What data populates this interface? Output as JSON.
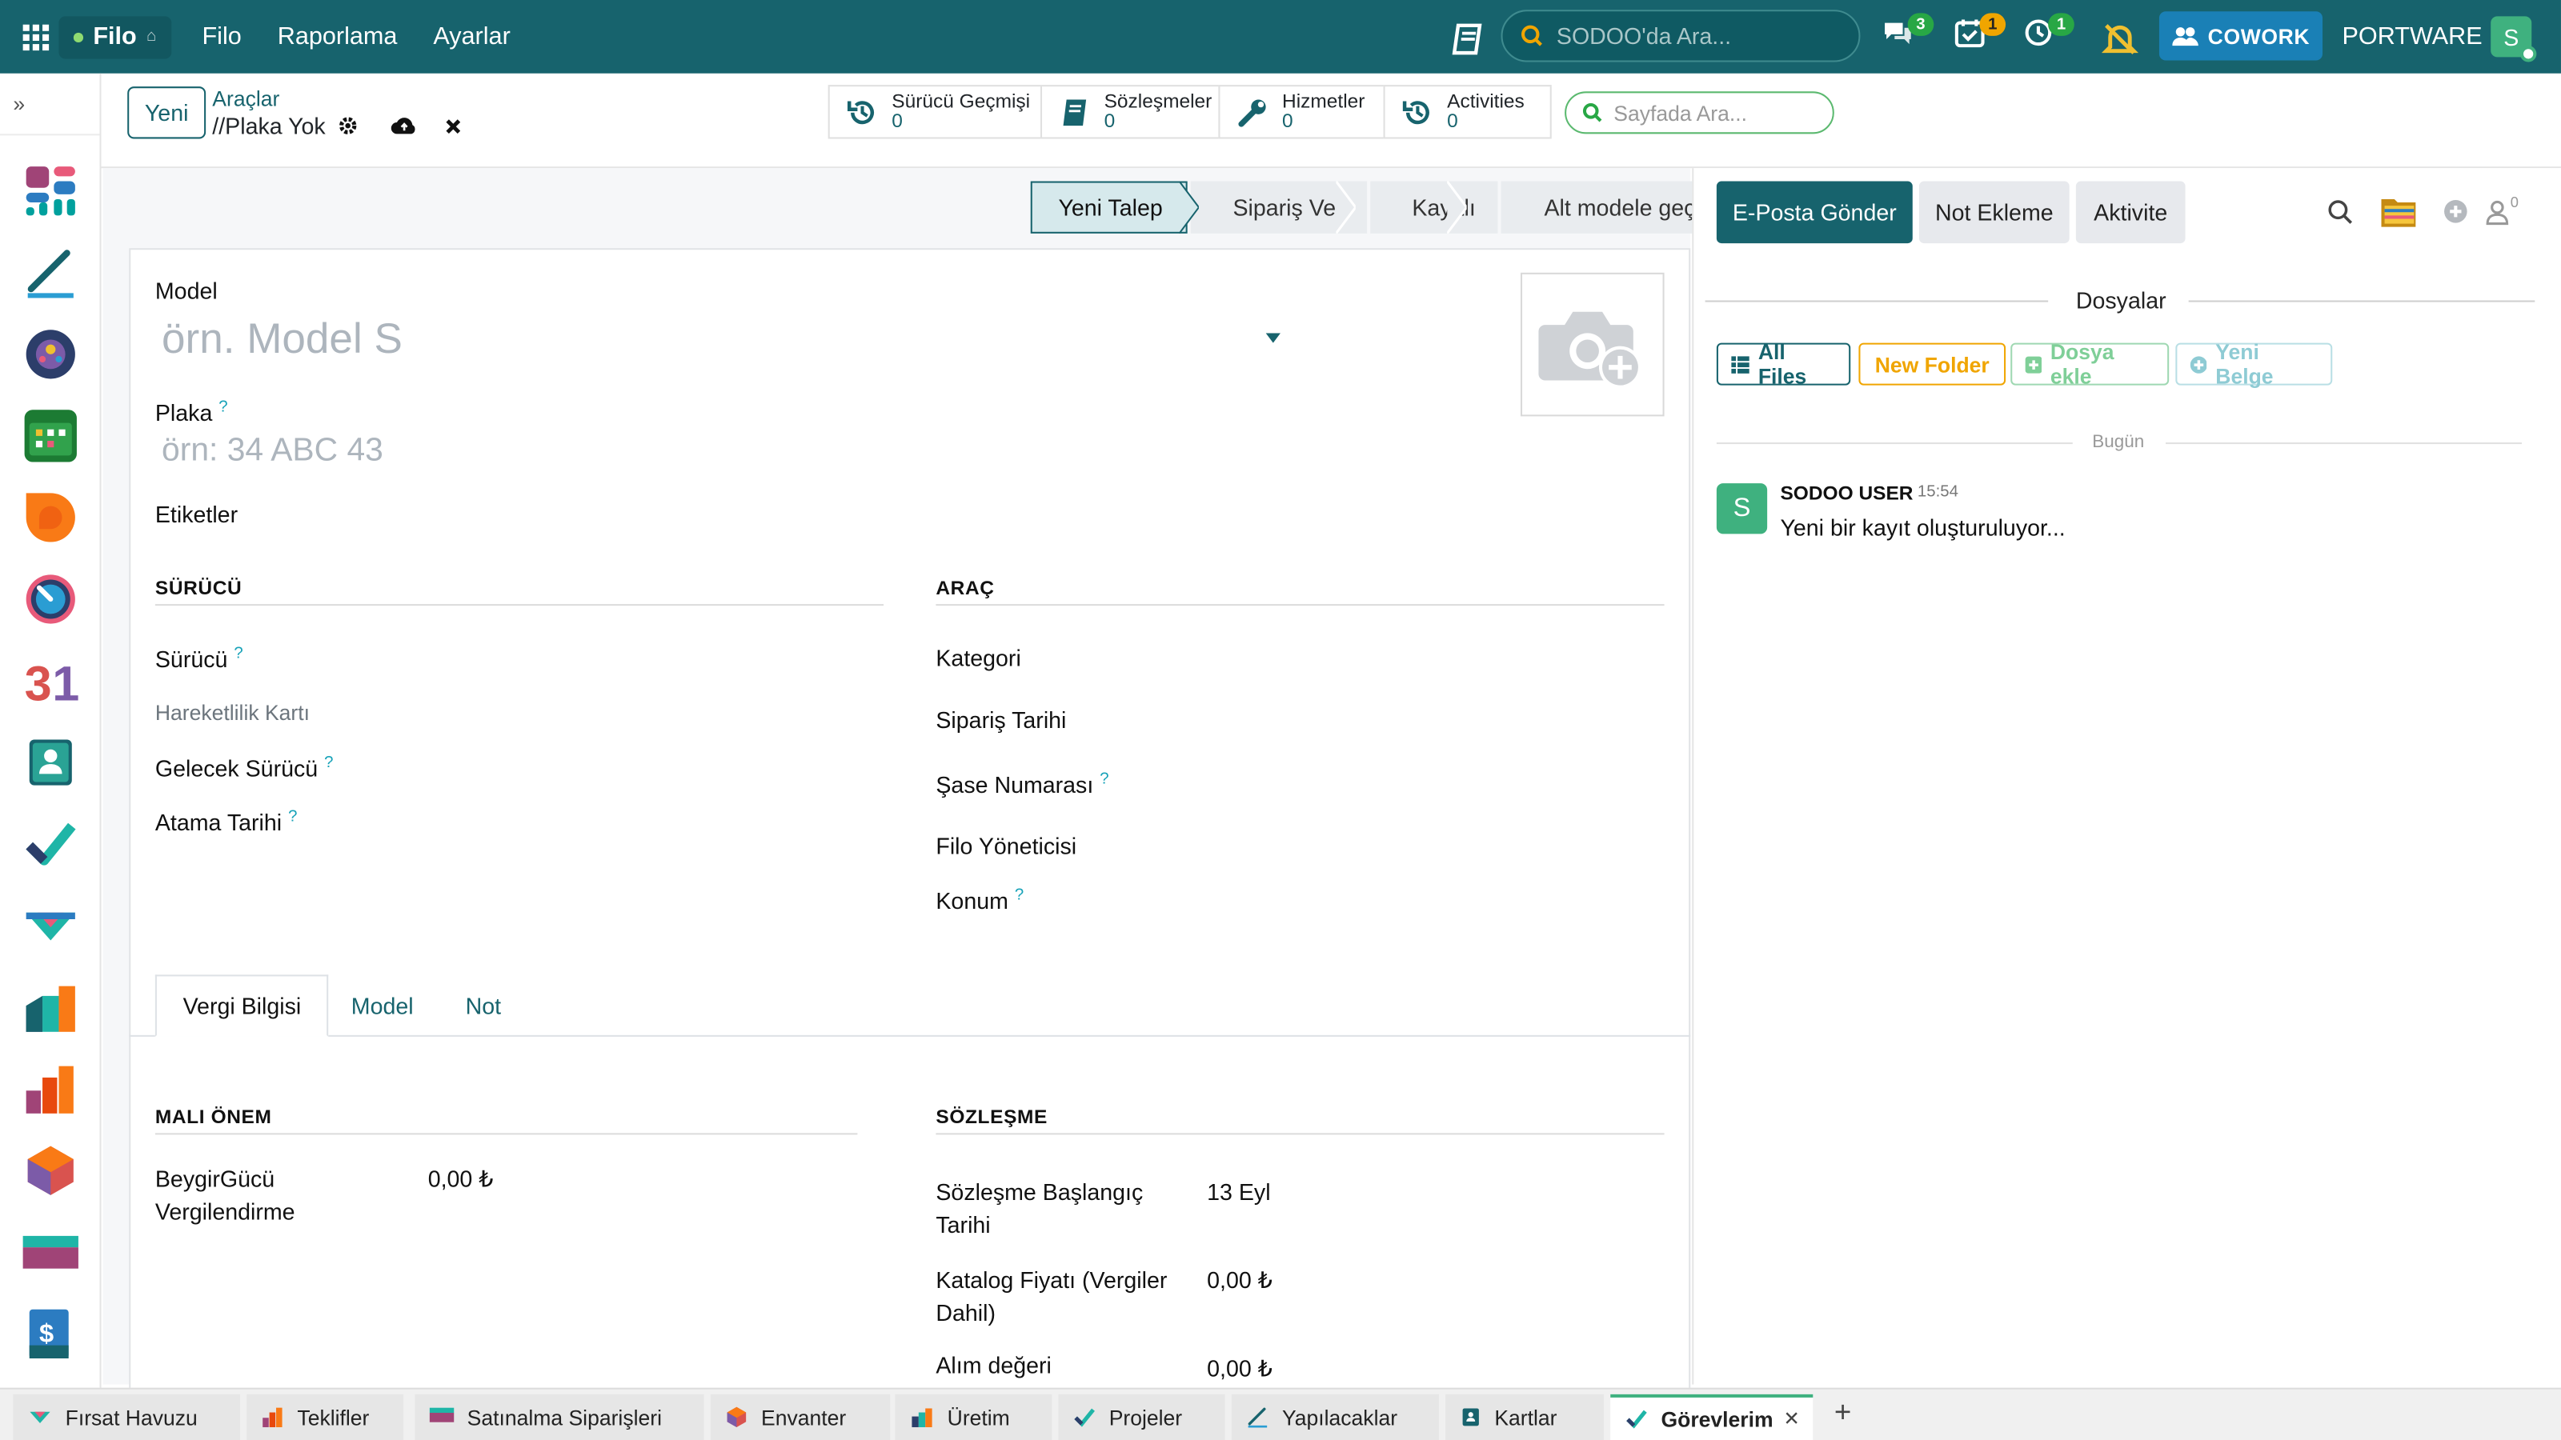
{
  "topbar": {
    "app_name": "Filo",
    "menu": [
      "Filo",
      "Raporlama",
      "Ayarlar"
    ],
    "search_placeholder": "SODOO'da Ara...",
    "messages_count": "3",
    "activities_count": "1",
    "timer_count": "1",
    "cowork_label": "COWORK",
    "company": "PORTWARE",
    "avatar_letter": "S"
  },
  "control_panel": {
    "new_button": "Yeni",
    "breadcrumb_parent": "Araçlar",
    "breadcrumb_current": "//Plaka Yok",
    "smart_buttons": [
      {
        "label": "Sürücü Geçmişi",
        "value": "0",
        "icon": "history-icon"
      },
      {
        "label": "Sözleşmeler",
        "value": "0",
        "icon": "book-icon"
      },
      {
        "label": "Hizmetler",
        "value": "0",
        "icon": "wrench-icon"
      },
      {
        "label": "Activities",
        "value": "0",
        "icon": "history-icon"
      }
    ],
    "page_search_placeholder": "Sayfada Ara..."
  },
  "status_stages": [
    "Yeni Talep",
    "Sipariş Ver",
    "Kayıtlı",
    "Alt modele geçildi"
  ],
  "form": {
    "model_label": "Model",
    "model_placeholder": "örn. Model S",
    "plate_label": "Plaka",
    "plate_placeholder": "örn: 34 ABC 43",
    "tags_label": "Etiketler",
    "help_mark": "?",
    "driver_section": "SÜRÜCÜ",
    "driver_label": "Sürücü",
    "mobility_card_label": "Hareketlilik Kartı",
    "future_driver_label": "Gelecek Sürücü",
    "assign_date_label": "Atama Tarihi",
    "vehicle_section": "ARAÇ",
    "category_label": "Kategori",
    "order_date_label": "Sipariş Tarihi",
    "chassis_label": "Şase Numarası",
    "fleet_manager_label": "Filo Yöneticisi",
    "location_label": "Konum"
  },
  "tabs": [
    "Vergi Bilgisi",
    "Model",
    "Not"
  ],
  "tax": {
    "fiscal_section": "MALI ÖNEM",
    "hp_tax_label_1": "BeygirGücü",
    "hp_tax_label_2": "Vergilendirme",
    "hp_tax_value": "0,00 ₺",
    "contract_section": "SÖZLEŞME",
    "contract_start_label_1": "Sözleşme Başlangıç",
    "contract_start_label_2": "Tarihi",
    "contract_start_value": "13 Eyl",
    "catalog_label_1": "Katalog Fiyatı (Vergiler",
    "catalog_label_2": "Dahil)",
    "catalog_value": "0,00 ₺",
    "purchase_label": "Alım değeri",
    "purchase_value": "0,00 ₺"
  },
  "chatter": {
    "send_email": "E-Posta Gönder",
    "log_note": "Not Ekleme",
    "activity": "Aktivite",
    "follower_count": "0",
    "files_title": "Dosyalar",
    "all_files": "All Files",
    "new_folder": "New Folder",
    "add_file": "Dosya ekle",
    "new_document": "Yeni Belge",
    "today": "Bugün",
    "author": "SODOO USER",
    "time": "15:54",
    "avatar_letter": "S",
    "message": "Yeni bir kayıt oluşturuluyor..."
  },
  "taskbar": [
    {
      "label": "Fırsat Havuzu",
      "icon": "crm-icon"
    },
    {
      "label": "Teklifler",
      "icon": "sales-icon"
    },
    {
      "label": "Satınalma Siparişleri",
      "icon": "purchase-icon"
    },
    {
      "label": "Envanter",
      "icon": "inventory-icon"
    },
    {
      "label": "Üretim",
      "icon": "manufacturing-icon"
    },
    {
      "label": "Projeler",
      "icon": "project-icon"
    },
    {
      "label": "Yapılacaklar",
      "icon": "todo-icon"
    },
    {
      "label": "Kartlar",
      "icon": "contacts-icon"
    },
    {
      "label": "Görevlerim",
      "icon": "tasks-icon"
    }
  ],
  "close_glyph": "✕",
  "add_tab_glyph": "+",
  "colors": {
    "primary": "#17636d",
    "accent": "#1a80b6",
    "success": "#3fb17f",
    "warning": "#f0a500"
  }
}
